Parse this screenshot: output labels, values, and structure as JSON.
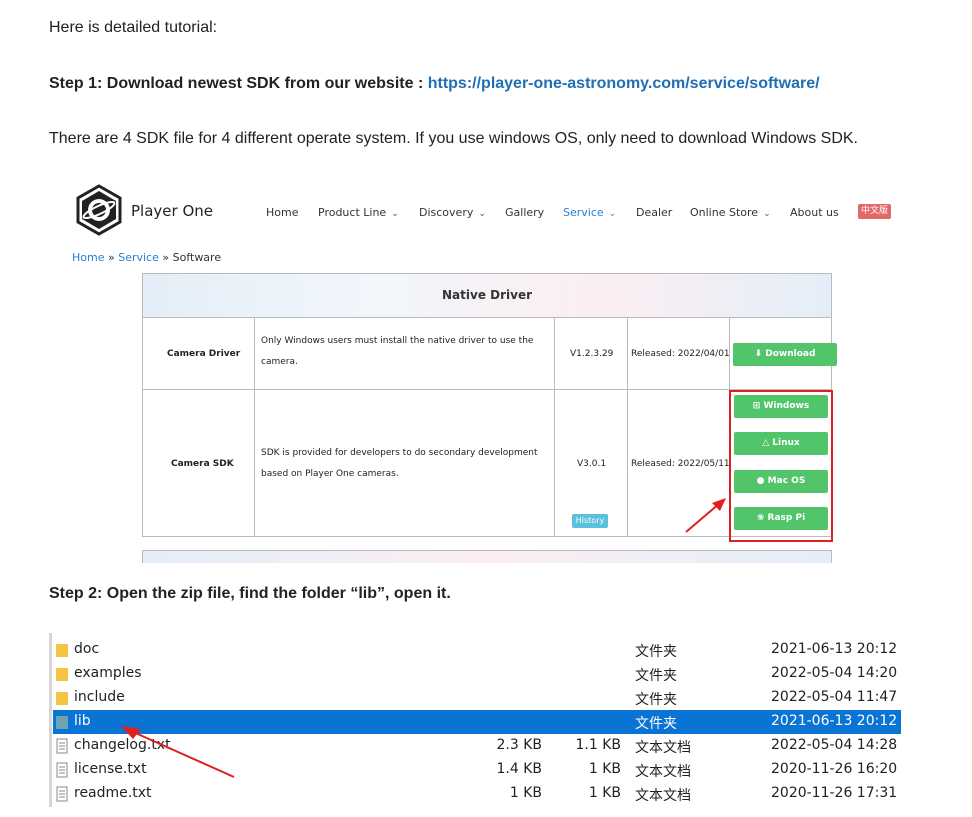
{
  "intro": "Here is detailed tutorial:",
  "step1": {
    "label": "Step 1: Download newest SDK from our website : ",
    "url": "https://player-one-astronomy.com/service/software/"
  },
  "os_note": "There are 4 SDK file for 4 different operate system. If you use windows OS, only need to download Windows SDK.",
  "site": {
    "brand": "Player One",
    "nav": [
      "Home",
      "Product Line",
      "Discovery",
      "Gallery",
      "Service",
      "Dealer",
      "Online Store",
      "About us"
    ],
    "lang": "中文版",
    "breadcrumb": {
      "home": "Home",
      "sep1": " » ",
      "service": "Service",
      "sep2": " » ",
      "current": "Software"
    },
    "table": {
      "title": "Native Driver",
      "rows": [
        {
          "name": "Camera Driver",
          "desc": [
            "Only Windows users must install the native driver to use the",
            "camera."
          ],
          "version": "V1.2.3.29",
          "released": "Released: 2022/04/01",
          "button": "Download"
        },
        {
          "name": "Camera SDK",
          "desc": [
            "SDK is provided for developers to do secondary development",
            "based on Player One cameras."
          ],
          "version": "V3.0.1",
          "history": "History",
          "released": "Released: 2022/05/11",
          "buttons": [
            "Windows",
            "Linux",
            "Mac OS",
            "Rasp Pi"
          ]
        }
      ]
    }
  },
  "step2": "Step 2: Open the zip file, find the folder “lib”,   open it.",
  "files": [
    {
      "name": "doc",
      "size": "",
      "packed": "",
      "type": "文件夹",
      "date": "2021-06-13 20:12",
      "kind": "folder"
    },
    {
      "name": "examples",
      "size": "",
      "packed": "",
      "type": "文件夹",
      "date": "2022-05-04 14:20",
      "kind": "folder"
    },
    {
      "name": "include",
      "size": "",
      "packed": "",
      "type": "文件夹",
      "date": "2022-05-04 11:47",
      "kind": "folder"
    },
    {
      "name": "lib",
      "size": "",
      "packed": "",
      "type": "文件夹",
      "date": "2021-06-13 20:12",
      "kind": "folder",
      "selected": true
    },
    {
      "name": "changelog.txt",
      "size": "2.3 KB",
      "packed": "1.1 KB",
      "type": "文本文档",
      "date": "2022-05-04 14:28",
      "kind": "file"
    },
    {
      "name": "license.txt",
      "size": "1.4 KB",
      "packed": "1 KB",
      "type": "文本文档",
      "date": "2020-11-26 16:20",
      "kind": "file"
    },
    {
      "name": "readme.txt",
      "size": "1 KB",
      "packed": "1 KB",
      "type": "文本文档",
      "date": "2020-11-26 17:31",
      "kind": "file"
    }
  ],
  "colors": {
    "link": "#1f6fb5",
    "button_green": "#52c46a",
    "highlight": "#e02020",
    "selection": "#0a74d4",
    "folder": "#f5c342"
  },
  "icons": [
    "player-one-logo-icon",
    "chevron-down-icon",
    "download-icon",
    "windows-icon",
    "linux-icon",
    "apple-icon",
    "raspberry-pi-icon",
    "folder-icon",
    "text-file-icon",
    "red-arrow-annotation"
  ]
}
